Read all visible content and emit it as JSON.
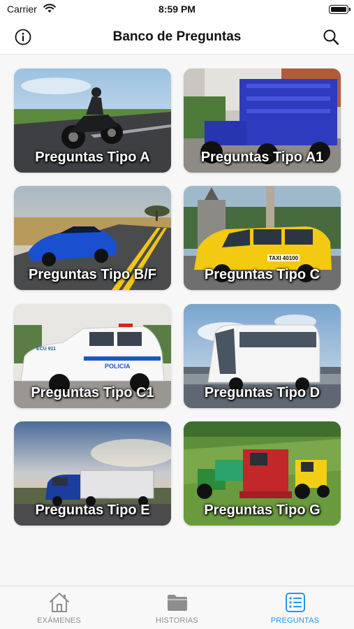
{
  "status_bar": {
    "carrier": "Carrier",
    "time": "8:59 PM"
  },
  "nav": {
    "title": "Banco de Preguntas",
    "info_icon": "info-icon",
    "search_icon": "search-icon"
  },
  "cards": [
    {
      "label": "Preguntas Tipo A"
    },
    {
      "label": "Preguntas Tipo A1"
    },
    {
      "label": "Preguntas Tipo B/F"
    },
    {
      "label": "Preguntas Tipo C"
    },
    {
      "label": "Preguntas Tipo C1"
    },
    {
      "label": "Preguntas Tipo D"
    },
    {
      "label": "Preguntas Tipo E"
    },
    {
      "label": "Preguntas Tipo G"
    }
  ],
  "photo_text": {
    "taxi_plate": "TAXI 40100",
    "police_text": "POLICIA",
    "police_unit": "ECU 911"
  },
  "tabs": [
    {
      "label": "EXÁMENES",
      "icon": "house-icon",
      "active": false
    },
    {
      "label": "HISTORIAS",
      "icon": "folder-icon",
      "active": false
    },
    {
      "label": "PREGUNTAS",
      "icon": "list-icon",
      "active": true
    }
  ],
  "colors": {
    "accent": "#2196f3",
    "inactive": "#8e8e8e"
  }
}
